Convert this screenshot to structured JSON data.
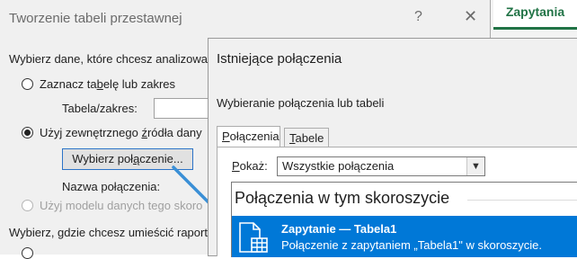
{
  "excel": {
    "ribbon_tab": "Zapytania",
    "accent": "#217346"
  },
  "back_dialog": {
    "title": "Tworzenie tabeli przestawnej",
    "help": "?",
    "close": "✕",
    "choose_data_label": "Wybierz dane, które chcesz analizowa",
    "option_range": {
      "pre": "Zaznacz ta",
      "u": "b",
      "post": "elę lub zakres"
    },
    "table_range_label": "Tabela/zakres:",
    "option_external": {
      "pre": "Użyj zewnętrznego ",
      "u": "ź",
      "post": "ródła dany"
    },
    "choose_connection_button": {
      "pre": "Wybierz poł",
      "u": "ą",
      "post": "czenie..."
    },
    "connection_name_label": "Nazwa połączenia:",
    "option_data_model": "Użyj modelu danych tego skoro",
    "choose_place_label": "Wybierz, gdzie chcesz umieścić raport"
  },
  "front_dialog": {
    "title": "Istniejące połączenia",
    "subtitle": "Wybieranie połączenia lub tabeli",
    "tabs": [
      {
        "pre": "",
        "u": "P",
        "post": "ołączenia"
      },
      {
        "pre": "",
        "u": "T",
        "post": "abele"
      }
    ],
    "show_label": {
      "pre": "",
      "u": "P",
      "post": "okaż:"
    },
    "show_value": "Wszystkie połączenia",
    "group_header": "Połączenia w tym skoroszycie",
    "connection": {
      "name": "Zapytanie — Tabela1",
      "description": "Połączenie z zapytaniem „Tabela1\" w skoroszycie."
    },
    "selection_color": "#0078d7"
  },
  "icons": {
    "close": "close-icon",
    "help": "help-icon",
    "dropdown": "chevron-down-icon",
    "connection": "table-connection-icon",
    "arrow": "arrow-annotation"
  }
}
